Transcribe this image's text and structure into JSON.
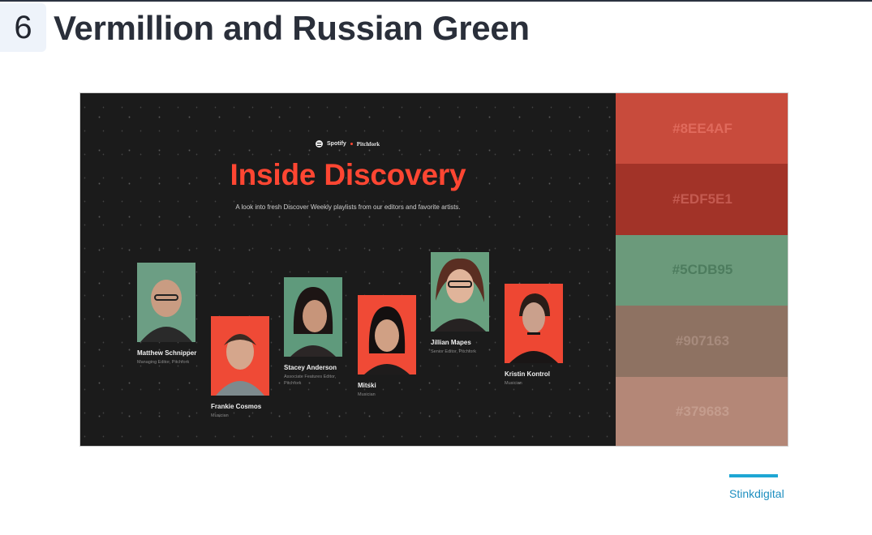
{
  "section": {
    "number": "6",
    "title": "Vermillion and Russian Green"
  },
  "screenshot": {
    "brand_left": "Spotify",
    "brand_right": "Pitchfork",
    "title": "Inside Discovery",
    "subtitle": "A look into fresh Discover Weekly playlists from our editors and favorite artists.",
    "people": [
      {
        "name": "Matthew Schnipper",
        "role": "Managing Editor, Pitchfork",
        "bg": "#6c9e84"
      },
      {
        "name": "Frankie Cosmos",
        "role": "Musician",
        "bg": "#ef4a36"
      },
      {
        "name": "Stacey Anderson",
        "role": "Associate Features Editor, Pitchfork",
        "bg": "#5f9a7c"
      },
      {
        "name": "Mitski",
        "role": "Musician",
        "bg": "#f04a36"
      },
      {
        "name": "Jillian Mapes",
        "role": "Senior Editor, Pitchfork",
        "bg": "#68a07f"
      },
      {
        "name": "Kristin Kontrol",
        "role": "Musician",
        "bg": "#ee4733"
      }
    ]
  },
  "palette": [
    {
      "label": "#8EE4AF",
      "bg": "#c84b3c",
      "fg": "#e06a5c"
    },
    {
      "label": "#EDF5E1",
      "bg": "#a23328",
      "fg": "#c45a50"
    },
    {
      "label": "#5CDB95",
      "bg": "#6b9a7b",
      "fg": "#4d7c5e"
    },
    {
      "label": "#907163",
      "bg": "#8e7262",
      "fg": "#a78b7d"
    },
    {
      "label": "#379683",
      "bg": "#b48777",
      "fg": "#c49c8d"
    }
  ],
  "credit": {
    "label": "Stinkdigital"
  }
}
